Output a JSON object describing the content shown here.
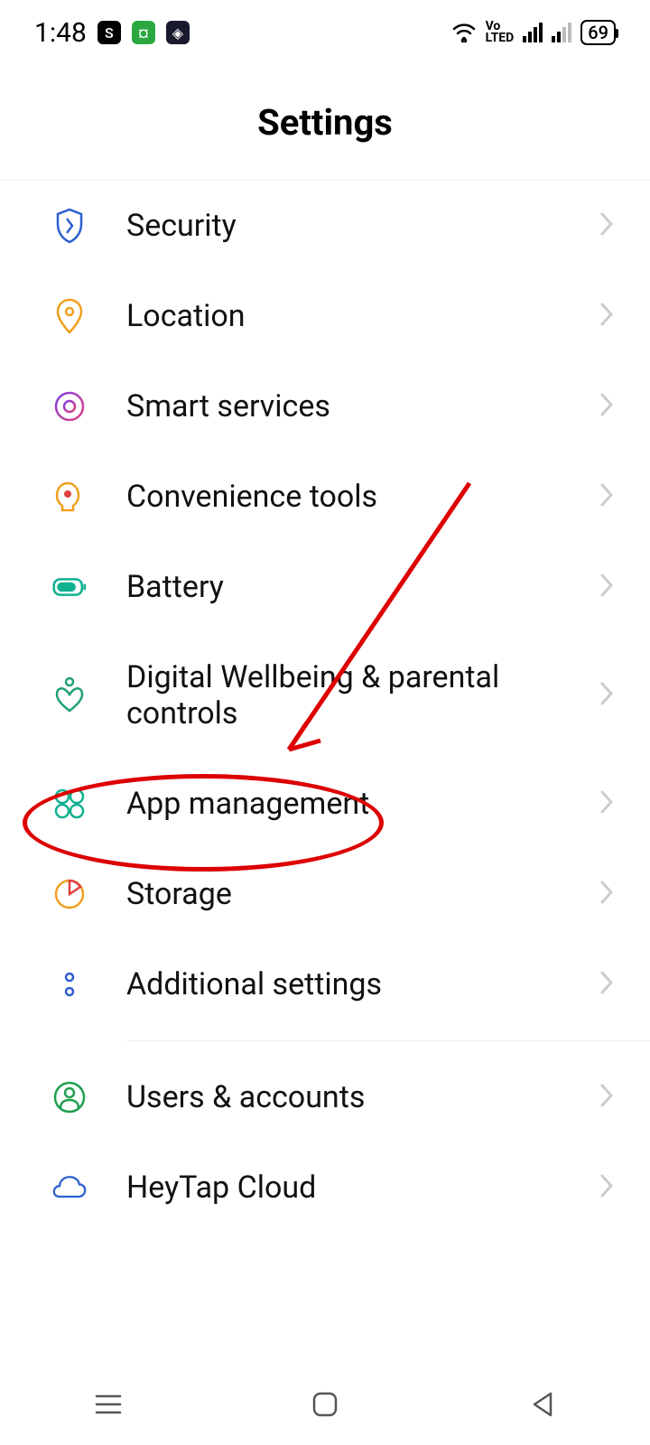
{
  "status": {
    "time": "1:48",
    "battery": "69"
  },
  "header": {
    "title": "Settings"
  },
  "items": [
    {
      "label": "Security",
      "icon": "shield"
    },
    {
      "label": "Location",
      "icon": "location"
    },
    {
      "label": "Smart services",
      "icon": "smart"
    },
    {
      "label": "Convenience tools",
      "icon": "convenience"
    },
    {
      "label": "Battery",
      "icon": "battery"
    },
    {
      "label": "Digital Wellbeing & parental controls",
      "icon": "wellbeing"
    },
    {
      "label": "App management",
      "icon": "apps"
    },
    {
      "label": "Storage",
      "icon": "storage"
    },
    {
      "label": "Additional settings",
      "icon": "additional"
    },
    {
      "label": "Users & accounts",
      "icon": "users"
    },
    {
      "label": "HeyTap Cloud",
      "icon": "cloud"
    }
  ]
}
